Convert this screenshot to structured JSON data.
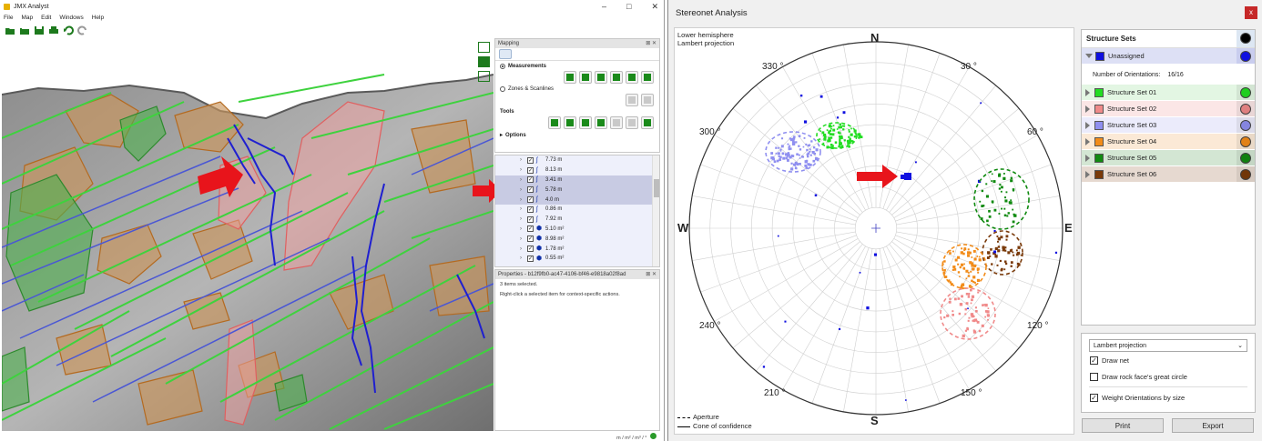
{
  "app": {
    "title": "JMX Analyst",
    "menu": [
      "File",
      "Map",
      "Edit",
      "Windows",
      "Help"
    ],
    "mapping_panel": {
      "title": "Mapping",
      "measurements_label": "Measurements",
      "zones_label": "Zones & Scanlines",
      "tools_label": "Tools",
      "options_label": "Options"
    },
    "list_items": [
      {
        "value": "7.73 m",
        "type": "line",
        "selected": false
      },
      {
        "value": "8.13 m",
        "type": "line",
        "selected": false
      },
      {
        "value": "3.41 m",
        "type": "line",
        "selected": true
      },
      {
        "value": "5.78 m",
        "type": "line",
        "selected": true
      },
      {
        "value": "4.0 m",
        "type": "line",
        "selected": true
      },
      {
        "value": "0.86 m",
        "type": "line",
        "selected": false
      },
      {
        "value": "7.92 m",
        "type": "line",
        "selected": false
      },
      {
        "value": "5.10 m²",
        "type": "area",
        "selected": false
      },
      {
        "value": "8.98 m²",
        "type": "area",
        "selected": false
      },
      {
        "value": "1.78 m²",
        "type": "area",
        "selected": false
      },
      {
        "value": "0.55 m²",
        "type": "area",
        "selected": false
      }
    ],
    "properties": {
      "title": "Properties - b12f9fb0-ac47-4106-bf46-e9818a02f8ad",
      "line1": "3 items selected.",
      "line2": "Right-click a selected item for context-specific actions."
    },
    "status_units": "m / m² / m³ / °"
  },
  "stereonet": {
    "title": "Stereonet Analysis",
    "projection_note_1": "Lower hemisphere",
    "projection_note_2": "Lambert projection",
    "compass": {
      "n": "N",
      "s": "S",
      "e": "E",
      "w": "W"
    },
    "angles": {
      "a330": "330 °",
      "a30": "30 °",
      "a300": "300 °",
      "a60": "60 °",
      "a240": "240 °",
      "a120": "120 °",
      "a210": "210 °",
      "a150": "150 °"
    },
    "legend_aperture": "Aperture",
    "legend_cone": "Cone of confidence",
    "sets_header": "Structure Sets",
    "unassigned": "Unassigned",
    "orient_label": "Number of Orientations:",
    "orient_value": "16/16",
    "sets": [
      {
        "name": "Structure Set 01",
        "color": "#22dd22",
        "bg": "#e3f6e3"
      },
      {
        "name": "Structure Set 02",
        "color": "#f08a8a",
        "bg": "#fbe6e6"
      },
      {
        "name": "Structure Set 03",
        "color": "#8f8ff0",
        "bg": "#ebebfb"
      },
      {
        "name": "Structure Set 04",
        "color": "#f28c1a",
        "bg": "#fbe9d6"
      },
      {
        "name": "Structure Set 05",
        "color": "#108a10",
        "bg": "#d3e6d3"
      },
      {
        "name": "Structure Set 06",
        "color": "#7a3a0a",
        "bg": "#e6d9d0"
      }
    ],
    "projection_select": "Lambert projection",
    "draw_net": "Draw net",
    "draw_rockface": "Draw rock face's great circle",
    "weight_orient": "Weight Orientations by size",
    "print_label": "Print",
    "export_label": "Export"
  }
}
